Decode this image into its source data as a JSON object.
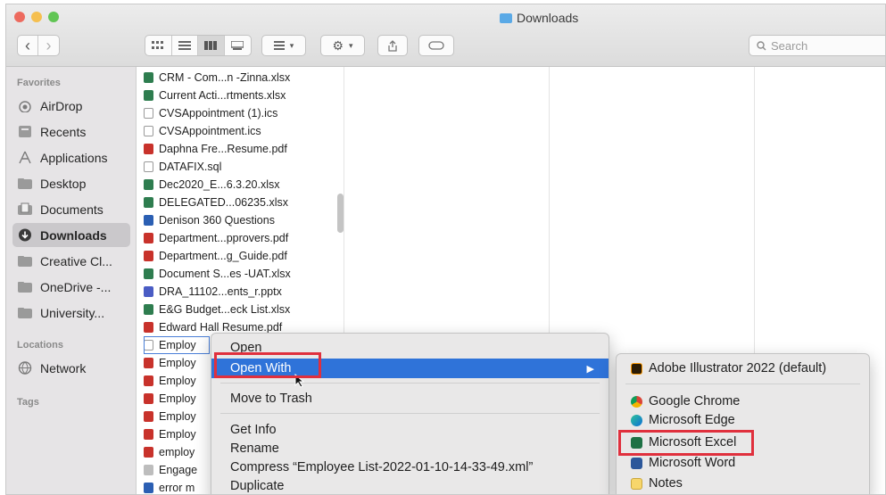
{
  "window": {
    "title": "Downloads"
  },
  "toolbar": {
    "back": "‹",
    "forward": "›",
    "search_placeholder": "Search"
  },
  "sidebar": {
    "favorites_heading": "Favorites",
    "favorites": [
      {
        "label": "AirDrop",
        "icon": "airdrop-icon"
      },
      {
        "label": "Recents",
        "icon": "recents-icon"
      },
      {
        "label": "Applications",
        "icon": "applications-icon"
      },
      {
        "label": "Desktop",
        "icon": "folder-icon"
      },
      {
        "label": "Documents",
        "icon": "documents-icon"
      },
      {
        "label": "Downloads",
        "icon": "downloads-icon",
        "selected": true
      },
      {
        "label": "Creative Cl...",
        "icon": "folder-icon"
      },
      {
        "label": "OneDrive -...",
        "icon": "folder-icon"
      },
      {
        "label": "University...",
        "icon": "folder-icon"
      }
    ],
    "locations_heading": "Locations",
    "locations": [
      {
        "label": "Network",
        "icon": "network-icon"
      }
    ],
    "tags_heading": "Tags"
  },
  "files": [
    {
      "name": "CRM - Com...n -Zinna.xlsx",
      "type": "xlsx"
    },
    {
      "name": "Current Acti...rtments.xlsx",
      "type": "xlsx"
    },
    {
      "name": "CVSAppointment (1).ics",
      "type": "ics"
    },
    {
      "name": "CVSAppointment.ics",
      "type": "ics"
    },
    {
      "name": "Daphna Fre...Resume.pdf",
      "type": "pdf"
    },
    {
      "name": "DATAFIX.sql",
      "type": "sql"
    },
    {
      "name": "Dec2020_E...6.3.20.xlsx",
      "type": "xlsx"
    },
    {
      "name": "DELEGATED...06235.xlsx",
      "type": "xlsx"
    },
    {
      "name": "Denison 360 Questions",
      "type": "doc"
    },
    {
      "name": "Department...pprovers.pdf",
      "type": "pdf"
    },
    {
      "name": "Department...g_Guide.pdf",
      "type": "pdf"
    },
    {
      "name": "Document S...es -UAT.xlsx",
      "type": "xlsx"
    },
    {
      "name": "DRA_11102...ents_r.pptx",
      "type": "pptx"
    },
    {
      "name": "E&G Budget...eck List.xlsx",
      "type": "xlsx"
    },
    {
      "name": "Edward Hall Resume.pdf",
      "type": "pdf"
    },
    {
      "name": "Employ",
      "type": "xml",
      "selected": true
    },
    {
      "name": "Employ",
      "type": "pdf"
    },
    {
      "name": "Employ",
      "type": "pdf"
    },
    {
      "name": "Employ",
      "type": "pdf"
    },
    {
      "name": "Employ",
      "type": "pdf"
    },
    {
      "name": "Employ",
      "type": "pdf"
    },
    {
      "name": "employ",
      "type": "pdf"
    },
    {
      "name": "Engage",
      "type": "doc2"
    },
    {
      "name": "error m",
      "type": "doc"
    }
  ],
  "context_menu": {
    "open": "Open",
    "open_with": "Open With",
    "move_to_trash": "Move to Trash",
    "get_info": "Get Info",
    "rename": "Rename",
    "compress": "Compress “Employee List-2022-01-10-14-33-49.xml”",
    "duplicate": "Duplicate"
  },
  "open_with_menu": {
    "default_app": "Adobe Illustrator 2022 (default)",
    "apps": [
      "Google Chrome",
      "Microsoft Edge",
      "Microsoft Excel",
      "Microsoft Word",
      "Notes"
    ]
  },
  "colors": {
    "highlight": "#2f73d9",
    "annotation": "#e0303d",
    "xlsx": "#2e7d4f",
    "pdf": "#c8322b",
    "doc": "#2b5fb3"
  }
}
